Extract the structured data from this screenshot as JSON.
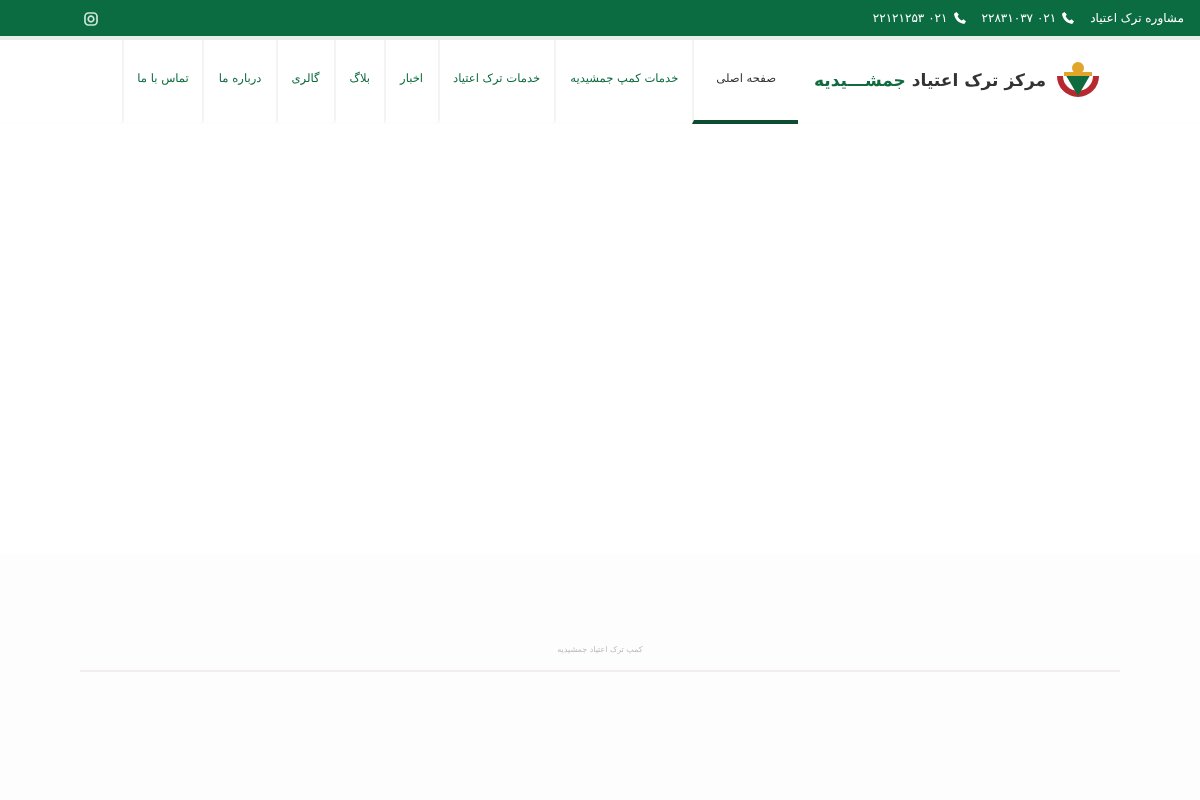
{
  "top_bar": {
    "items": [
      {
        "kind": "text",
        "label": "مشاوره ترک اعتیاد"
      },
      {
        "kind": "phone",
        "label": "۰۲۱ ۲۲۸۳۱۰۳۷"
      },
      {
        "kind": "phone",
        "label": "۰۲۱ ۲۲۱۲۱۲۵۳"
      }
    ]
  },
  "logo": {
    "title": "مرکز ترک اعتیاد",
    "highlight": "جمشـــیدیه"
  },
  "nav": [
    {
      "label": "صفحه اصلی",
      "selected": true
    },
    {
      "label": "خدمات کمپ جمشیدیه",
      "selected": false
    },
    {
      "label": "خدمات ترک اعتیاد",
      "selected": false
    },
    {
      "label": "اخبار",
      "selected": false
    },
    {
      "label": "بلاگ",
      "selected": false
    },
    {
      "label": "گالری",
      "selected": false
    },
    {
      "label": "درباره ما",
      "selected": false
    },
    {
      "label": "تماس با ما",
      "selected": false
    }
  ],
  "footer": {
    "title": "کمپ ترک اعتیاد جمشیدیه"
  }
}
